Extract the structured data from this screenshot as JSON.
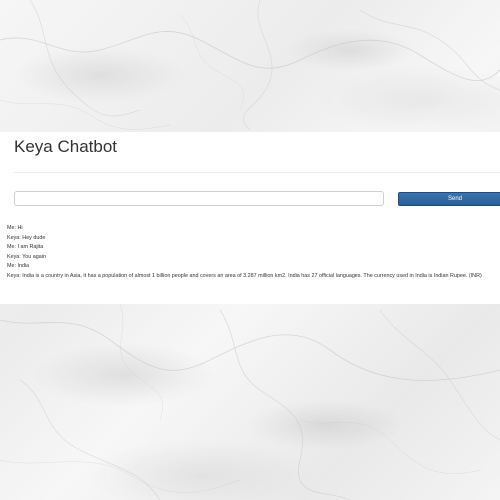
{
  "page": {
    "title": "Keya Chatbot"
  },
  "input": {
    "value": "",
    "placeholder": ""
  },
  "send_button": {
    "label": "Send"
  },
  "messages": [
    {
      "speaker": "Me",
      "text": "Me: Hi"
    },
    {
      "speaker": "Keya",
      "text": "Keya: Hey dude"
    },
    {
      "speaker": "Me",
      "text": "Me: I am Rajita"
    },
    {
      "speaker": "Keya",
      "text": "Keya: You again"
    },
    {
      "speaker": "Me",
      "text": "Me: India"
    },
    {
      "speaker": "Keya",
      "text": "Keya: India is a country in Asia, it has a population of almost 1 billion people and covers an area of 3.287 million km2. India has 27 official languages. The currency used in India is Indian Rupee. (INR)"
    }
  ],
  "colors": {
    "send_button_bg": "#2a5d95",
    "panel_bg": "#ffffff",
    "background": "#f3f3f3"
  }
}
